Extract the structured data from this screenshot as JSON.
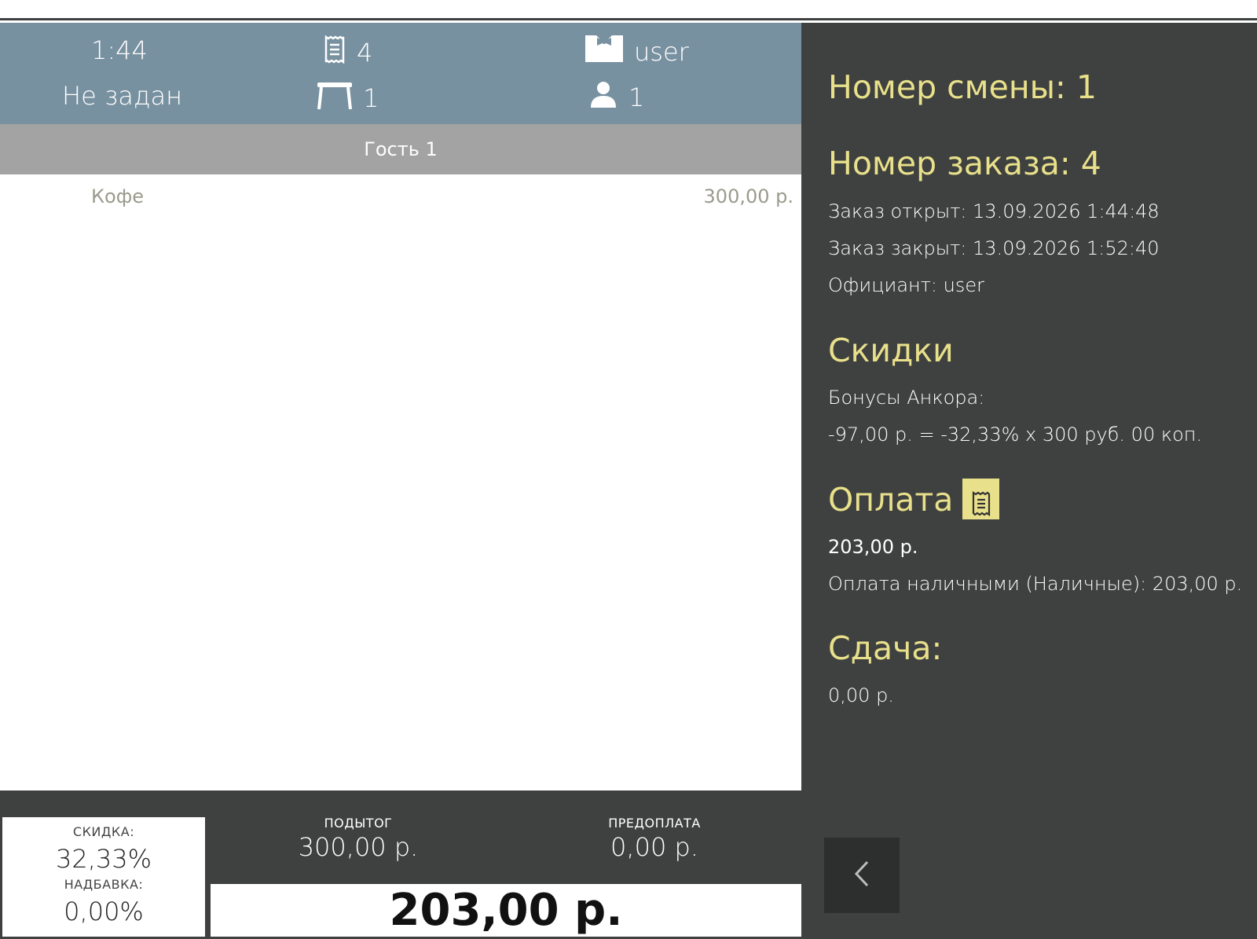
{
  "header": {
    "time": "1:44",
    "order_count": "4",
    "waiter": "user",
    "status": "Не задан",
    "table": "1",
    "guests": "1"
  },
  "guest_tab": "Гость 1",
  "items": [
    {
      "name": "Кофе",
      "price": "300,00 р."
    }
  ],
  "summary": {
    "discount_label": "СКИДКА:",
    "discount_value": "32,33%",
    "markup_label": "НАДБАВКА:",
    "markup_value": "0,00%",
    "subtotal_label": "ПОДЫТОГ",
    "subtotal_value": "300,00 р.",
    "prepay_label": "ПРЕДОПЛАТА",
    "prepay_value": "0,00 р.",
    "total": "203,00 р."
  },
  "details": {
    "shift": "Номер смены: 1",
    "order": "Номер заказа: 4",
    "opened": "Заказ открыт: 13.09.2026 1:44:48",
    "closed": "Заказ закрыт: 13.09.2026 1:52:40",
    "waiter": "Официант: user",
    "discounts_title": "Скидки",
    "discount_name": "Бонусы Анкора:",
    "discount_formula": "-97,00 р. = -32,33% x 300 руб. 00 коп.",
    "payment_title": "Оплата",
    "payment_total": "203,00 р.",
    "payment_line": "Оплата наличными (Наличные): 203,00 р.",
    "change_title": "Сдача:",
    "change_value": "0,00 р."
  },
  "icons": {
    "order": "receipt-icon",
    "waiter": "bowtie-icon",
    "table": "table-icon",
    "guest": "person-icon",
    "receipt_button": "receipt-icon",
    "back": "chevron-left-icon"
  },
  "colors": {
    "header_bg": "#7891a0",
    "guest_bar": "#a3a3a3",
    "panel_bg": "#3f4140",
    "accent": "#e8e08a"
  }
}
